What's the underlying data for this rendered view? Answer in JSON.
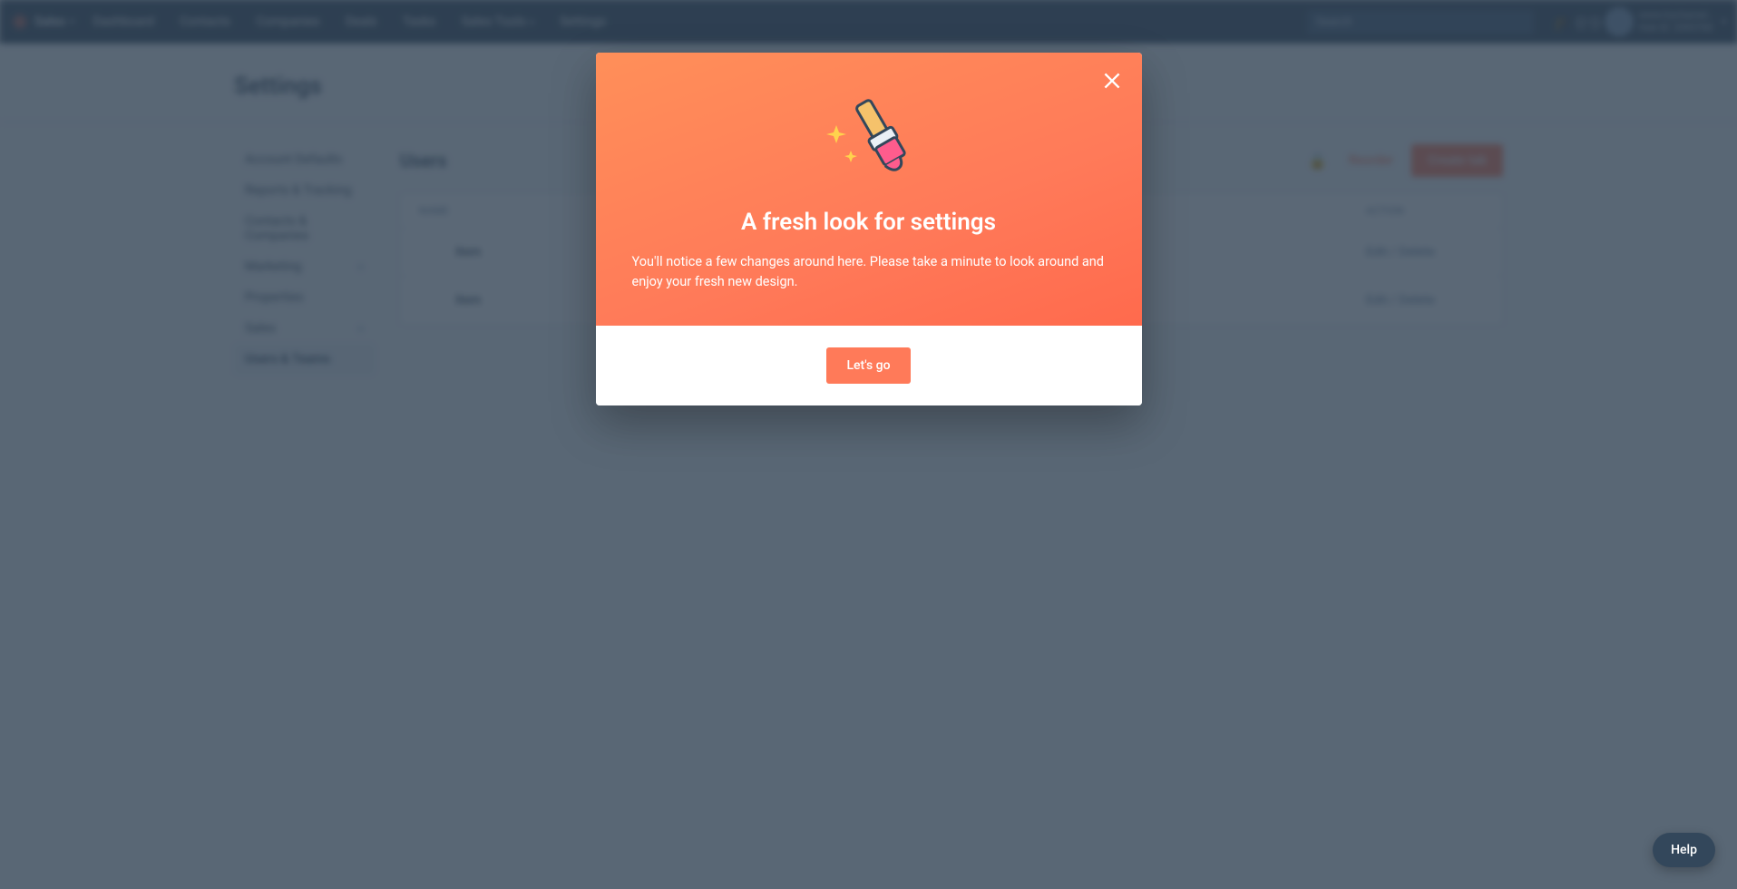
{
  "nav": {
    "brand": "Sales",
    "items": [
      "Dashboard",
      "Contacts",
      "Companies",
      "Deals",
      "Tasks",
      "Sales Tools",
      "Settings"
    ],
    "search_placeholder": "Search",
    "account_line1": "www.trychamel...",
    "account_line2": "Hub ID: 3393760"
  },
  "page": {
    "title": "Settings"
  },
  "sidebar": {
    "items": [
      {
        "label": "Account Defaults",
        "exp": false
      },
      {
        "label": "Reports & Tracking",
        "exp": false
      },
      {
        "label": "Contacts & Companies",
        "exp": false
      },
      {
        "label": "Marketing",
        "exp": true
      },
      {
        "label": "Properties",
        "exp": false
      },
      {
        "label": "Sales",
        "exp": true
      },
      {
        "label": "Users & Teams",
        "exp": false,
        "active": true
      }
    ]
  },
  "main": {
    "heading": "Users",
    "reorder": "Reorder",
    "create": "Create tab",
    "col_name": "NAME",
    "col_action": "ACTION",
    "rows": [
      {
        "name": "Item",
        "action": "Edit / Delete"
      },
      {
        "name": "Item",
        "action": "Edit / Delete"
      }
    ]
  },
  "modal": {
    "title": "A fresh look for settings",
    "body": "You'll notice a few changes around here. Please take a minute to look around and enjoy your fresh new design.",
    "cta": "Let's go"
  },
  "help": {
    "label": "Help"
  }
}
